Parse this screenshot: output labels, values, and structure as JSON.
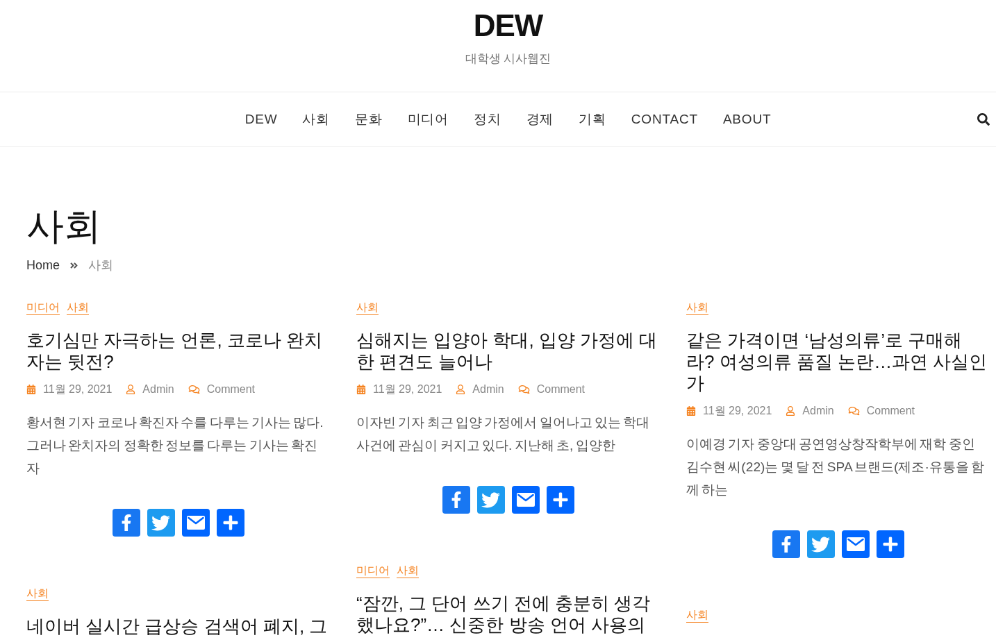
{
  "site": {
    "title": "DEW",
    "tagline": "대학생 시사웹진"
  },
  "nav": {
    "items": [
      {
        "label": "DEW"
      },
      {
        "label": "사회"
      },
      {
        "label": "문화"
      },
      {
        "label": "미디어"
      },
      {
        "label": "정치"
      },
      {
        "label": "경제"
      },
      {
        "label": "기획"
      },
      {
        "label": "CONTACT"
      },
      {
        "label": "ABOUT"
      }
    ]
  },
  "page": {
    "title": "사회",
    "breadcrumb": [
      {
        "label": "Home",
        "kind": "link"
      },
      {
        "label": "사회",
        "kind": "current"
      }
    ]
  },
  "columns": [
    {
      "posts": [
        {
          "categories": [
            "미디어",
            "사회"
          ],
          "title": "호기심만 자극하는 언론, 코로나 완치자는 뒷전?",
          "date": "11월 29, 2021",
          "author": "Admin",
          "comments": "Comment",
          "excerpt": "황서현 기자 코로나 확진자 수를 다루는 기사는 많다. 그러나 완치자의 정확한 정보를 다루는 기사는 확진자",
          "share": [
            {
              "kind": "facebook"
            },
            {
              "kind": "twitter"
            },
            {
              "kind": "email"
            },
            {
              "kind": "more"
            }
          ]
        },
        {
          "categories": [
            "사회"
          ],
          "title": "네이버 실시간 급상승 검색어 폐지, 그"
        }
      ]
    },
    {
      "posts": [
        {
          "categories": [
            "사회"
          ],
          "title": "심해지는 입양아 학대, 입양 가정에 대한 편견도 늘어나",
          "date": "11월 29, 2021",
          "author": "Admin",
          "comments": "Comment",
          "excerpt": "이자빈 기자 최근 입양 가정에서 일어나고 있는 학대 사건에 관심이 커지고 있다. 지난해 초, 입양한",
          "share": [
            {
              "kind": "facebook"
            },
            {
              "kind": "twitter"
            },
            {
              "kind": "email"
            },
            {
              "kind": "more"
            }
          ]
        },
        {
          "categories": [
            "미디어",
            "사회"
          ],
          "title": "“잠깐, 그 단어 쓰기 전에 충분히 생각했나요?”… 신중한 방송 언어 사용의"
        }
      ]
    },
    {
      "posts": [
        {
          "categories": [
            "사회"
          ],
          "title": "같은 가격이면 ‘남성의류’로 구매해라? 여성의류 품질 논란…과연 사실인가",
          "date": "11월 29, 2021",
          "author": "Admin",
          "comments": "Comment",
          "excerpt": "이예경 기자 중앙대 공연영상창작학부에 재학 중인 김수현 씨(22)는 몇 달 전 SPA 브랜드(제조·유통을 함께 하는",
          "share": [
            {
              "kind": "facebook"
            },
            {
              "kind": "twitter"
            },
            {
              "kind": "email"
            },
            {
              "kind": "more"
            }
          ]
        },
        {
          "categories": [
            "사회"
          ]
        }
      ]
    }
  ]
}
